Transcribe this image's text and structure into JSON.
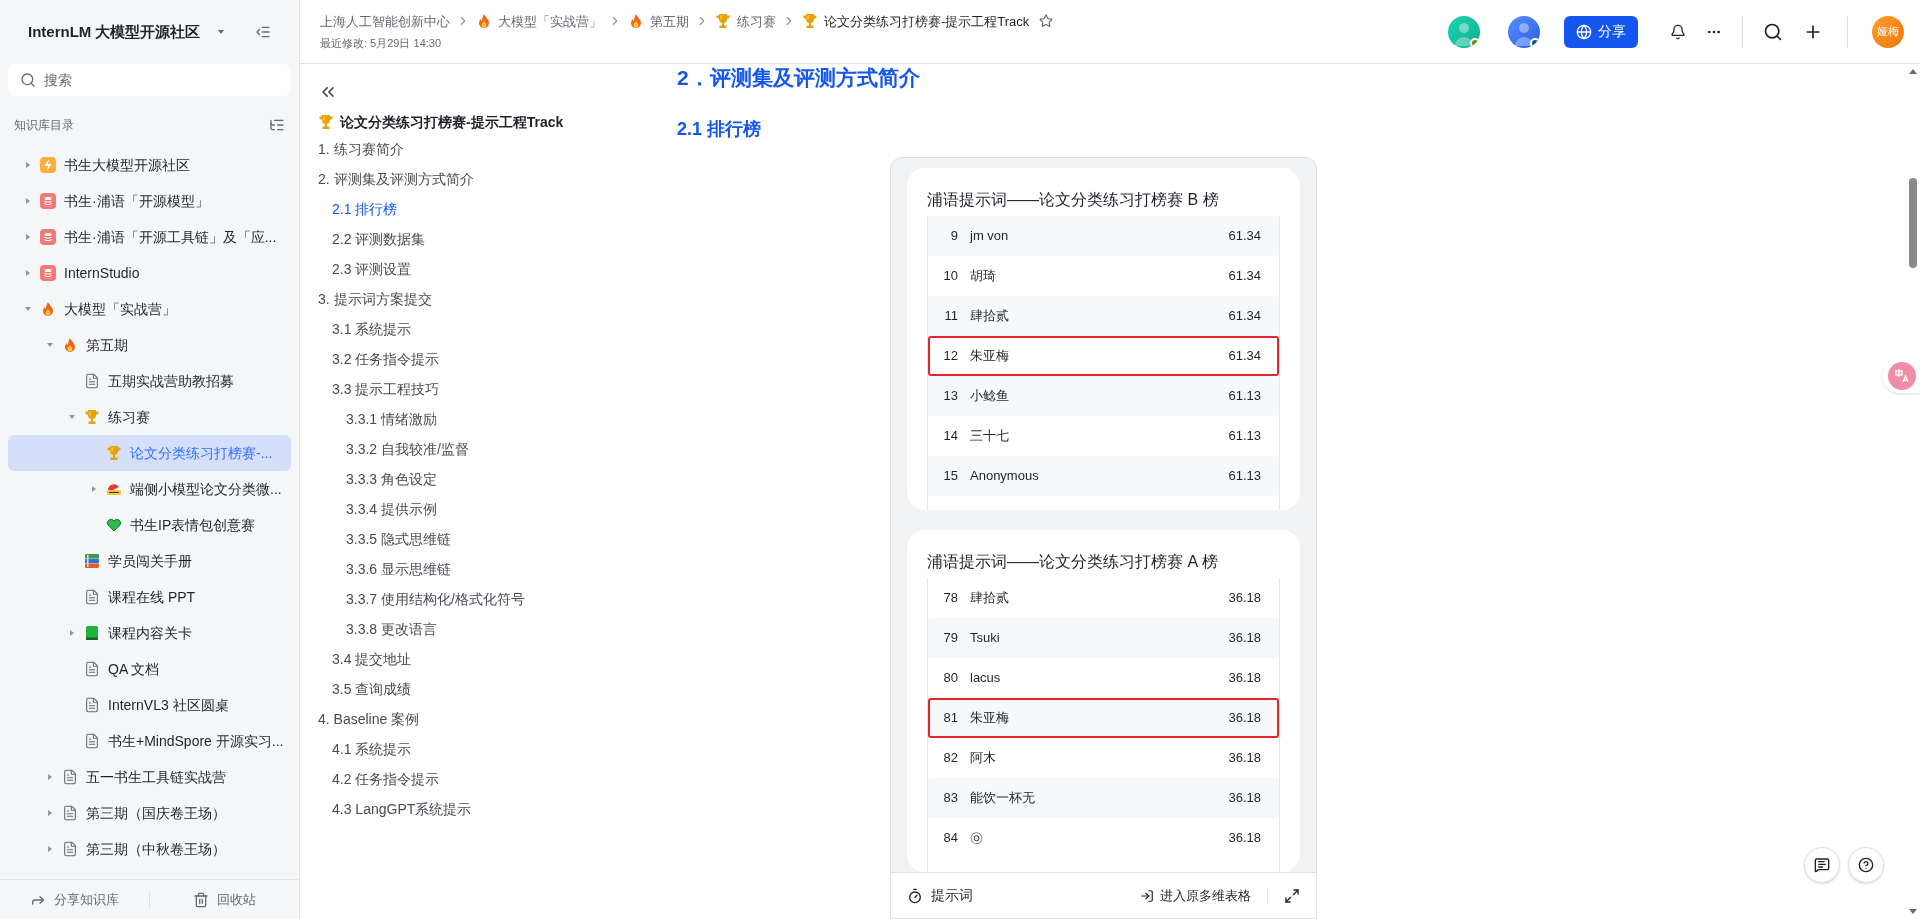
{
  "sidebar": {
    "space_title": "InternLM 大模型开源社区",
    "search": {
      "placeholder": "搜索"
    },
    "section_label": "知识库目录",
    "tree": [
      {
        "label": "书生大模型开源社区",
        "kind": "lightning",
        "expanded": false,
        "selected": false
      },
      {
        "label": "书生·浦语「开源模型」",
        "kind": "logo",
        "expanded": false,
        "selected": false
      },
      {
        "label": "书生·浦语「开源工具链」及「应...",
        "kind": "logo",
        "expanded": false,
        "selected": false
      },
      {
        "label": "InternStudio",
        "kind": "logo",
        "expanded": false,
        "selected": false
      },
      {
        "label": "大模型「实战营」",
        "kind": "fire",
        "expanded": true,
        "selected": false,
        "children": [
          {
            "label": "第五期",
            "kind": "fire",
            "expanded": true,
            "selected": false,
            "children": [
              {
                "label": "五期实战营助教招募",
                "kind": "doc",
                "selected": false
              },
              {
                "label": "练习赛",
                "kind": "trophy",
                "expanded": true,
                "selected": false,
                "children": [
                  {
                    "label": "论文分类练习打榜赛-...",
                    "kind": "trophy",
                    "selected": true
                  },
                  {
                    "label": "端侧小模型论文分类微...",
                    "kind": "helmet",
                    "expanded": false,
                    "selected": false
                  },
                  {
                    "label": "书生IP表情包创意赛",
                    "kind": "heart",
                    "selected": false
                  }
                ]
              },
              {
                "label": "学员闯关手册",
                "kind": "books",
                "selected": false
              },
              {
                "label": "课程在线 PPT",
                "kind": "doc",
                "selected": false
              },
              {
                "label": "课程内容关卡",
                "kind": "book",
                "expanded": false,
                "selected": false
              },
              {
                "label": "QA 文档",
                "kind": "doc",
                "selected": false
              },
              {
                "label": "InternVL3 社区圆桌",
                "kind": "doc",
                "selected": false
              },
              {
                "label": "书生+MindSpore 开源实习...",
                "kind": "doc",
                "selected": false
              }
            ]
          },
          {
            "label": "五一书生工具链实战营",
            "kind": "doc",
            "expanded": false,
            "selected": false
          },
          {
            "label": "第三期（国庆卷王场）",
            "kind": "doc",
            "expanded": false,
            "selected": false
          },
          {
            "label": "第三期（中秋卷王场）",
            "kind": "doc",
            "expanded": false,
            "selected": false
          }
        ]
      }
    ],
    "footer": [
      "分享知识库",
      "回收站"
    ]
  },
  "header": {
    "breadcrumbs": [
      {
        "label": "上海人工智能创新中心",
        "kind": "plain"
      },
      {
        "label": "大模型「实战营」",
        "kind": "fire"
      },
      {
        "label": "第五期",
        "kind": "fire"
      },
      {
        "label": "练习赛",
        "kind": "trophy"
      },
      {
        "label": "论文分类练习打榜赛-提示工程Track",
        "kind": "trophy"
      }
    ],
    "modified": "最近修改: 5月29日 14:30",
    "share_button": "分享",
    "user_avatar": "娅梅"
  },
  "toc": {
    "title": "论文分类练习打榜赛-提示工程Track",
    "items": [
      {
        "label": "1. 练习赛简介",
        "selected": false
      },
      {
        "label": "2. 评测集及评测方式简介",
        "selected": false,
        "children": [
          {
            "label": "2.1 排行榜",
            "selected": true
          },
          {
            "label": "2.2 评测数据集",
            "selected": false
          },
          {
            "label": "2.3 评测设置",
            "selected": false
          }
        ]
      },
      {
        "label": "3. 提示词方案提交",
        "selected": false,
        "children": [
          {
            "label": "3.1 系统提示",
            "selected": false
          },
          {
            "label": "3.2 任务指令提示",
            "selected": false
          },
          {
            "label": "3.3 提示工程技巧",
            "selected": false,
            "children": [
              {
                "label": "3.3.1 情绪激励",
                "selected": false
              },
              {
                "label": "3.3.2 自我较准/监督",
                "selected": false
              },
              {
                "label": "3.3.3 角色设定",
                "selected": false
              },
              {
                "label": "3.3.4 提供示例",
                "selected": false
              },
              {
                "label": "3.3.5 隐式思维链",
                "selected": false
              },
              {
                "label": "3.3.6 显示思维链",
                "selected": false
              },
              {
                "label": "3.3.7 使用结构化/格式化符号",
                "selected": false
              },
              {
                "label": "3.3.8 更改语言",
                "selected": false
              }
            ]
          },
          {
            "label": "3.4 提交地址",
            "selected": false
          },
          {
            "label": "3.5 查询成绩",
            "selected": false
          }
        ]
      },
      {
        "label": "4. Baseline 案例",
        "selected": false,
        "children": [
          {
            "label": "4.1 系统提示",
            "selected": false
          },
          {
            "label": "4.2 任务指令提示",
            "selected": false
          },
          {
            "label": "4.3 LangGPT系统提示",
            "selected": false
          }
        ]
      }
    ]
  },
  "document": {
    "heading": "2．评测集及评测方式简介",
    "subheading": "2.1 排行榜",
    "embed": {
      "boards": [
        {
          "title": "浦语提示词——论文分类练习打榜赛 B 榜",
          "rows": [
            {
              "rank": "9",
              "name": "jm von",
              "score": "61.34",
              "highlighted": false
            },
            {
              "rank": "10",
              "name": "胡琦",
              "score": "61.34",
              "highlighted": false
            },
            {
              "rank": "11",
              "name": "肆拾贰",
              "score": "61.34",
              "highlighted": false
            },
            {
              "rank": "12",
              "name": "朱亚梅",
              "score": "61.34",
              "highlighted": true
            },
            {
              "rank": "13",
              "name": "小鲶鱼",
              "score": "61.13",
              "highlighted": false
            },
            {
              "rank": "14",
              "name": "三十七",
              "score": "61.13",
              "highlighted": false
            },
            {
              "rank": "15",
              "name": "Anonymous",
              "score": "61.13",
              "highlighted": false
            }
          ]
        },
        {
          "title": "浦语提示词——论文分类练习打榜赛 A 榜",
          "rows": [
            {
              "rank": "78",
              "name": "肆拾贰",
              "score": "36.18",
              "highlighted": false
            },
            {
              "rank": "79",
              "name": "Tsuki",
              "score": "36.18",
              "highlighted": false
            },
            {
              "rank": "80",
              "name": "lacus",
              "score": "36.18",
              "highlighted": false
            },
            {
              "rank": "81",
              "name": "朱亚梅",
              "score": "36.18",
              "highlighted": true
            },
            {
              "rank": "82",
              "name": "阿木",
              "score": "36.18",
              "highlighted": false
            },
            {
              "rank": "83",
              "name": "能饮一杯无",
              "score": "36.18",
              "highlighted": false
            },
            {
              "rank": "84",
              "name": "㉧",
              "score": "36.18",
              "highlighted": false
            }
          ]
        }
      ],
      "footer_left": "提示词",
      "footer_right": "进入原多维表格"
    }
  }
}
